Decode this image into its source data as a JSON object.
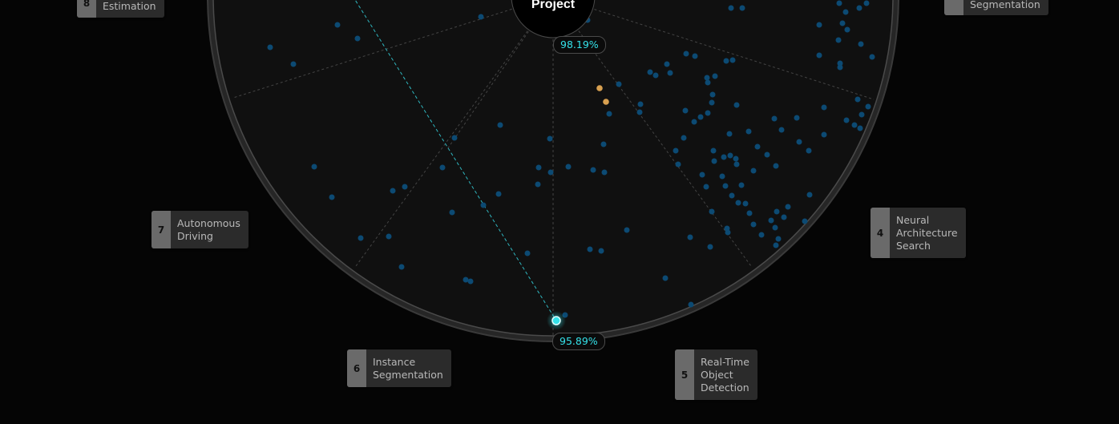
{
  "center": {
    "title": "Project"
  },
  "readouts": {
    "top_percent": "98.19%",
    "bottom_percent": "95.89%"
  },
  "labels": [
    {
      "num": "8",
      "text": "Estimation"
    },
    {
      "num": "",
      "text": "Segmentation"
    },
    {
      "num": "7",
      "text": "Autonomous\nDriving"
    },
    {
      "num": "4",
      "text": "Neural\nArchitecture\nSearch"
    },
    {
      "num": "6",
      "text": "Instance\nSegmentation"
    },
    {
      "num": "5",
      "text": "Real-Time\nObject\nDetection"
    }
  ],
  "colors": {
    "background": "#050505",
    "dial": "#101010",
    "rim": "#3a3a3a",
    "point": "#0c4a73",
    "highlight": "#d8a050",
    "accent": "#34e2ea"
  }
}
